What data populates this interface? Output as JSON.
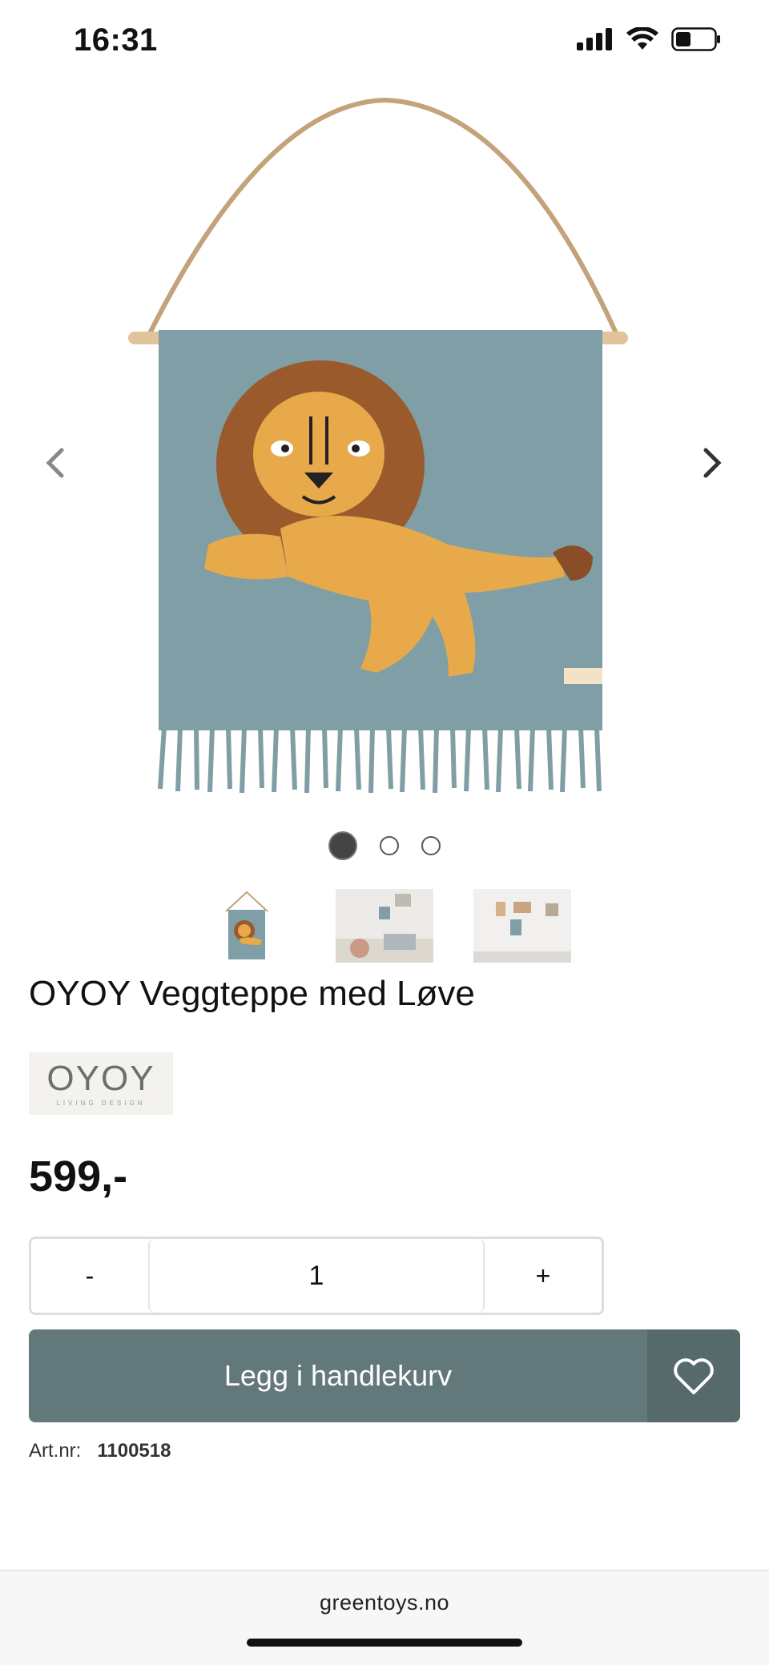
{
  "status_bar": {
    "time": "16:31",
    "icons": [
      "signal-icon",
      "wifi-icon",
      "battery-icon"
    ]
  },
  "gallery": {
    "main_image": "lion-wall-hanging",
    "prev_icon": "chevron-left-icon",
    "next_icon": "chevron-right-icon",
    "dots": [
      {
        "active": true
      },
      {
        "active": false
      },
      {
        "active": false
      }
    ],
    "thumbnails": [
      "lion-wall-hanging-thumb",
      "kids-room-thumb",
      "wall-display-thumb"
    ]
  },
  "product": {
    "title": "OYOY Veggteppe med Løve",
    "brand_logo_text": "OYOY",
    "brand_logo_subtext": "LIVING DESIGN",
    "price": "599,-"
  },
  "quantity": {
    "minus_label": "-",
    "value": "1",
    "plus_label": "+"
  },
  "cart": {
    "add_label": "Legg i handlekurv",
    "wishlist_icon": "heart-icon"
  },
  "article": {
    "label": "Art.nr:",
    "value": "1100518"
  },
  "browser": {
    "url": "greentoys.no"
  },
  "colors": {
    "button": "#63787a",
    "rug": "#7f9ea6",
    "lion": "#e7a94a"
  }
}
